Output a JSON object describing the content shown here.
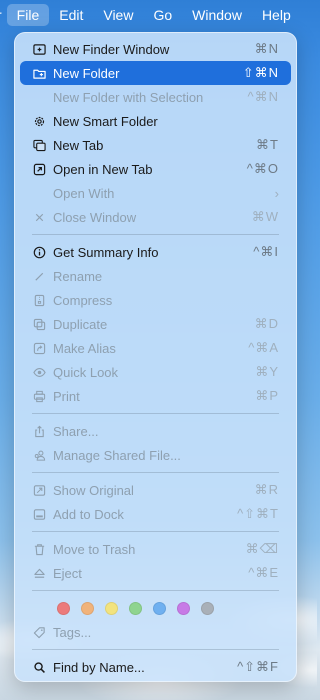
{
  "menubar": {
    "partial": "r",
    "items": [
      "File",
      "Edit",
      "View",
      "Go",
      "Window",
      "Help"
    ],
    "active": "File"
  },
  "menu": {
    "items": {
      "new_finder_window": {
        "label": "New Finder Window",
        "shortcut": "⌘N",
        "icon": "finder-window-icon"
      },
      "new_folder": {
        "label": "New Folder",
        "shortcut": "⇧⌘N",
        "icon": "folder-plus-icon"
      },
      "new_folder_selection": {
        "label": "New Folder with Selection",
        "shortcut": "^⌘N"
      },
      "new_smart_folder": {
        "label": "New Smart Folder",
        "icon": "gear-icon"
      },
      "new_tab": {
        "label": "New Tab",
        "shortcut": "⌘T",
        "icon": "tabs-icon"
      },
      "open_new_tab": {
        "label": "Open in New Tab",
        "shortcut": "^⌘O",
        "icon": "open-arrow-icon"
      },
      "open_with": {
        "label": "Open With",
        "submenu": "›"
      },
      "close_window": {
        "label": "Close Window",
        "shortcut": "⌘W",
        "icon": "close-icon"
      },
      "get_summary_info": {
        "label": "Get Summary Info",
        "shortcut": "^⌘I",
        "icon": "info-icon"
      },
      "rename": {
        "label": "Rename",
        "icon": "pencil-icon"
      },
      "compress": {
        "label": "Compress",
        "icon": "archive-icon"
      },
      "duplicate": {
        "label": "Duplicate",
        "shortcut": "⌘D",
        "icon": "duplicate-icon"
      },
      "make_alias": {
        "label": "Make Alias",
        "shortcut": "^⌘A",
        "icon": "alias-icon"
      },
      "quick_look": {
        "label": "Quick Look",
        "shortcut": "⌘Y",
        "icon": "eye-icon"
      },
      "print": {
        "label": "Print",
        "shortcut": "⌘P",
        "icon": "printer-icon"
      },
      "share": {
        "label": "Share...",
        "icon": "share-icon"
      },
      "manage_shared": {
        "label": "Manage Shared File...",
        "icon": "people-icon"
      },
      "show_original": {
        "label": "Show Original",
        "shortcut": "⌘R",
        "icon": "show-original-icon"
      },
      "add_to_dock": {
        "label": "Add to Dock",
        "shortcut": "^⇧⌘T",
        "icon": "dock-icon"
      },
      "move_to_trash": {
        "label": "Move to Trash",
        "shortcut": "⌘⌫",
        "icon": "trash-icon"
      },
      "eject": {
        "label": "Eject",
        "shortcut": "^⌘E",
        "icon": "eject-icon"
      },
      "tags": {
        "label": "Tags...",
        "icon": "tag-icon"
      },
      "find_by_name": {
        "label": "Find by Name...",
        "shortcut": "^⇧⌘F",
        "icon": "magnifier-icon"
      }
    },
    "tag_colors": [
      "#ec7b7c",
      "#f1b37a",
      "#f2e37e",
      "#8fd48f",
      "#6fb0f0",
      "#c77ae6",
      "#a9b0b8"
    ]
  }
}
